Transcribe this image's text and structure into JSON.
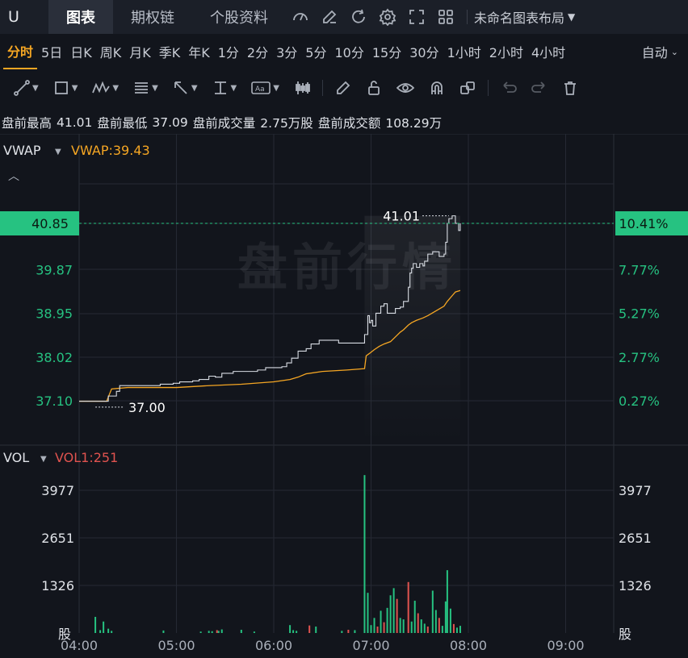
{
  "topbar": {
    "symbol": "U",
    "tabs": [
      "图表",
      "期权链",
      "个股资料"
    ],
    "active_tab": 0,
    "layout_label": "未命名图表布局"
  },
  "periods": {
    "items": [
      "分时",
      "5日",
      "日K",
      "周K",
      "月K",
      "季K",
      "年K",
      "1分",
      "2分",
      "3分",
      "5分",
      "10分",
      "15分",
      "30分",
      "1小时",
      "2小时",
      "4小时"
    ],
    "active": 0,
    "auto_label": "自动"
  },
  "info": {
    "high_label": "盘前最高",
    "high": "41.01",
    "low_label": "盘前最低",
    "low": "37.09",
    "vol_label": "盘前成交量",
    "vol": "2.75万股",
    "amount_label": "盘前成交额",
    "amount": "108.29万"
  },
  "price_panel": {
    "indicator": "VWAP",
    "indicator_value": "VWAP:39.43",
    "watermark": "盘前行情",
    "current_price": "40.85",
    "current_pct": "10.41%",
    "high_marker": "41.01",
    "low_marker": "37.00"
  },
  "vol_panel": {
    "indicator": "VOL",
    "indicator_value": "VOL1:251",
    "unit": "股"
  },
  "colors": {
    "up": "#26c281",
    "down": "#e0534f",
    "vwap": "#f5a623",
    "price_line": "#d8dce3",
    "current_tag": "#26c281"
  },
  "chart_data": {
    "type": "line",
    "x_ticks": [
      "04:00",
      "05:00",
      "06:00",
      "07:00",
      "08:00",
      "09:00"
    ],
    "y_ticks_left": [
      "40.85",
      "39.87",
      "38.95",
      "38.02",
      "37.10"
    ],
    "y_ticks_right": [
      "10.41%",
      "7.77%",
      "5.27%",
      "2.77%",
      "0.27%"
    ],
    "vol_ticks": [
      "3977",
      "2651",
      "1326"
    ],
    "price_series": {
      "t": [
        0,
        17,
        18,
        20,
        23,
        25,
        26,
        30,
        48,
        50,
        58,
        62,
        70,
        74,
        80,
        84,
        88,
        95,
        110,
        115,
        125,
        128,
        131,
        135,
        140,
        143,
        148,
        150,
        160,
        175,
        176,
        178,
        179,
        180,
        181,
        183,
        185,
        186,
        188,
        190,
        195,
        198,
        200,
        203,
        204,
        205,
        206,
        208,
        210,
        212,
        213,
        215,
        218,
        222,
        225,
        226,
        227,
        228,
        230,
        232,
        234,
        235
      ],
      "p": [
        37.09,
        37.09,
        37.2,
        37.2,
        37.3,
        37.42,
        37.42,
        37.42,
        37.42,
        37.45,
        37.47,
        37.5,
        37.52,
        37.55,
        37.62,
        37.6,
        37.68,
        37.72,
        37.75,
        37.8,
        37.82,
        37.9,
        38.0,
        38.15,
        38.2,
        38.3,
        38.38,
        38.38,
        38.32,
        38.32,
        38.5,
        38.9,
        38.75,
        38.8,
        38.68,
        38.95,
        38.95,
        39.1,
        39.15,
        38.95,
        39.05,
        39.08,
        39.2,
        39.5,
        39.8,
        39.9,
        40.0,
        39.92,
        40.0,
        39.95,
        40.05,
        40.2,
        40.25,
        40.15,
        40.2,
        40.45,
        40.85,
        40.95,
        41.01,
        40.85,
        40.7,
        40.85
      ]
    },
    "vwap_series": {
      "t": [
        0,
        17,
        18,
        20,
        30,
        60,
        80,
        100,
        120,
        130,
        135,
        140,
        150,
        165,
        176,
        177,
        179,
        182,
        185,
        188,
        192,
        195,
        198,
        200,
        203,
        205,
        208,
        212,
        215,
        220,
        225,
        227,
        230,
        232,
        235
      ],
      "p": [
        37.09,
        37.09,
        37.18,
        37.35,
        37.38,
        37.38,
        37.42,
        37.45,
        37.5,
        37.55,
        37.6,
        37.67,
        37.72,
        37.75,
        37.78,
        38.05,
        38.1,
        38.18,
        38.25,
        38.3,
        38.35,
        38.45,
        38.55,
        38.6,
        38.7,
        38.75,
        38.8,
        38.85,
        38.9,
        39.0,
        39.1,
        39.2,
        39.32,
        39.4,
        39.43
      ]
    },
    "volume_series": [
      {
        "t": 10,
        "v": 450,
        "d": "up"
      },
      {
        "t": 13,
        "v": 80,
        "d": "up"
      },
      {
        "t": 15,
        "v": 320,
        "d": "up"
      },
      {
        "t": 18,
        "v": 120,
        "d": "up"
      },
      {
        "t": 20,
        "v": 60,
        "d": "up"
      },
      {
        "t": 52,
        "v": 70,
        "d": "up"
      },
      {
        "t": 75,
        "v": 40,
        "d": "up"
      },
      {
        "t": 80,
        "v": 60,
        "d": "up"
      },
      {
        "t": 82,
        "v": 50,
        "d": "up"
      },
      {
        "t": 85,
        "v": 80,
        "d": "down"
      },
      {
        "t": 86,
        "v": 60,
        "d": "up"
      },
      {
        "t": 88,
        "v": 100,
        "d": "up"
      },
      {
        "t": 100,
        "v": 90,
        "d": "up"
      },
      {
        "t": 108,
        "v": 40,
        "d": "up"
      },
      {
        "t": 130,
        "v": 220,
        "d": "up"
      },
      {
        "t": 132,
        "v": 80,
        "d": "up"
      },
      {
        "t": 134,
        "v": 60,
        "d": "up"
      },
      {
        "t": 142,
        "v": 210,
        "d": "down"
      },
      {
        "t": 146,
        "v": 180,
        "d": "up"
      },
      {
        "t": 162,
        "v": 60,
        "d": "up"
      },
      {
        "t": 166,
        "v": 90,
        "d": "down"
      },
      {
        "t": 170,
        "v": 80,
        "d": "up"
      },
      {
        "t": 176,
        "v": 4400,
        "d": "up"
      },
      {
        "t": 178,
        "v": 1120,
        "d": "up"
      },
      {
        "t": 180,
        "v": 220,
        "d": "up"
      },
      {
        "t": 182,
        "v": 420,
        "d": "up"
      },
      {
        "t": 184,
        "v": 180,
        "d": "down"
      },
      {
        "t": 186,
        "v": 620,
        "d": "up"
      },
      {
        "t": 188,
        "v": 300,
        "d": "down"
      },
      {
        "t": 190,
        "v": 700,
        "d": "up"
      },
      {
        "t": 192,
        "v": 1050,
        "d": "up"
      },
      {
        "t": 194,
        "v": 1250,
        "d": "up"
      },
      {
        "t": 196,
        "v": 950,
        "d": "down"
      },
      {
        "t": 198,
        "v": 420,
        "d": "up"
      },
      {
        "t": 200,
        "v": 380,
        "d": "up"
      },
      {
        "t": 203,
        "v": 1420,
        "d": "down"
      },
      {
        "t": 205,
        "v": 320,
        "d": "up"
      },
      {
        "t": 207,
        "v": 900,
        "d": "up"
      },
      {
        "t": 209,
        "v": 550,
        "d": "down"
      },
      {
        "t": 211,
        "v": 380,
        "d": "up"
      },
      {
        "t": 213,
        "v": 260,
        "d": "up"
      },
      {
        "t": 215,
        "v": 180,
        "d": "down"
      },
      {
        "t": 218,
        "v": 1180,
        "d": "up"
      },
      {
        "t": 220,
        "v": 640,
        "d": "up"
      },
      {
        "t": 222,
        "v": 420,
        "d": "down"
      },
      {
        "t": 224,
        "v": 200,
        "d": "up"
      },
      {
        "t": 226,
        "v": 880,
        "d": "up"
      },
      {
        "t": 227,
        "v": 1750,
        "d": "up"
      },
      {
        "t": 229,
        "v": 680,
        "d": "up"
      },
      {
        "t": 231,
        "v": 250,
        "d": "down"
      },
      {
        "t": 233,
        "v": 150,
        "d": "up"
      },
      {
        "t": 235,
        "v": 200,
        "d": "up"
      }
    ]
  }
}
